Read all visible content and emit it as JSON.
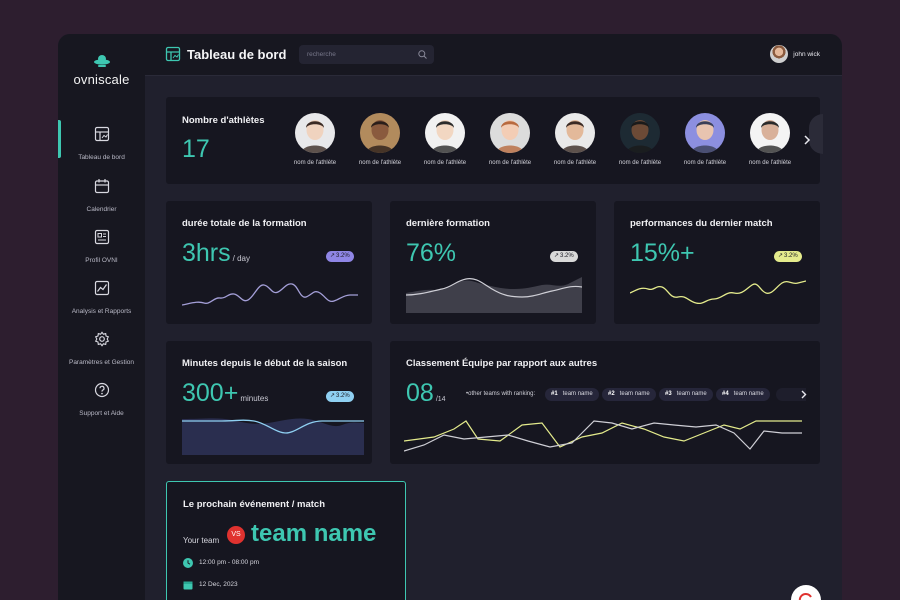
{
  "app": {
    "name": "ovniscale"
  },
  "header": {
    "title": "Tableau de bord",
    "search_placeholder": "recherche",
    "user_name": "john wick"
  },
  "sidebar": {
    "items": [
      {
        "label": "Tableau de bord",
        "icon": "dashboard-icon"
      },
      {
        "label": "Calendrier",
        "icon": "calendar-icon"
      },
      {
        "label": "Profil OVNI",
        "icon": "profile-card-icon"
      },
      {
        "label": "Analysis et Rapports",
        "icon": "chart-icon"
      },
      {
        "label": "Paramètres et Gestion",
        "icon": "gear-icon"
      },
      {
        "label": "Support et Aide",
        "icon": "help-icon"
      }
    ]
  },
  "athletes": {
    "title": "Nombre d'athlètes",
    "count": "17",
    "items": [
      {
        "name": "nom de l'athlète"
      },
      {
        "name": "nom de l'athlète"
      },
      {
        "name": "nom de l'athlète"
      },
      {
        "name": "nom de l'athlète"
      },
      {
        "name": "nom de l'athlète"
      },
      {
        "name": "nom de l'athlète"
      },
      {
        "name": "nom de l'athlète"
      },
      {
        "name": "nom de l'athlète"
      }
    ]
  },
  "stats": {
    "training_total": {
      "title": "durée totale de la formation",
      "value": "3hrs",
      "unit": "/ day",
      "change": "3.2%",
      "badge_color": "#8f86e6"
    },
    "last_training": {
      "title": "dernière formation",
      "value": "76%",
      "change": "3.2%",
      "badge_color": "#d9d9d9"
    },
    "last_match": {
      "title": "performances du dernier match",
      "value": "15%+",
      "change": "3.2%",
      "badge_color": "#e4eb8c"
    },
    "season_minutes": {
      "title": "Minutes depuis le début de la saison",
      "value": "300+",
      "unit": "minutes",
      "change": "3.2%",
      "badge_color": "#8fd0f2"
    }
  },
  "ranking": {
    "title": "Classement Équipe par rapport aux autres",
    "value": "08",
    "unit": "/14",
    "other_label": "•other teams with ranking:",
    "teams": [
      {
        "rank": "#1",
        "name": "team name"
      },
      {
        "rank": "#2",
        "name": "team name"
      },
      {
        "rank": "#3",
        "name": "team name"
      },
      {
        "rank": "#4",
        "name": "team name"
      }
    ]
  },
  "event": {
    "title": "Le prochain événement / match",
    "your_team": "Your team",
    "vs": "VS",
    "opponent": "team name",
    "time": "12:00 pm - 08:00 pm",
    "date": "12 Dec, 2023"
  },
  "colors": {
    "accent": "#3ec7b1",
    "background": "#20202d",
    "card": "#161620"
  }
}
